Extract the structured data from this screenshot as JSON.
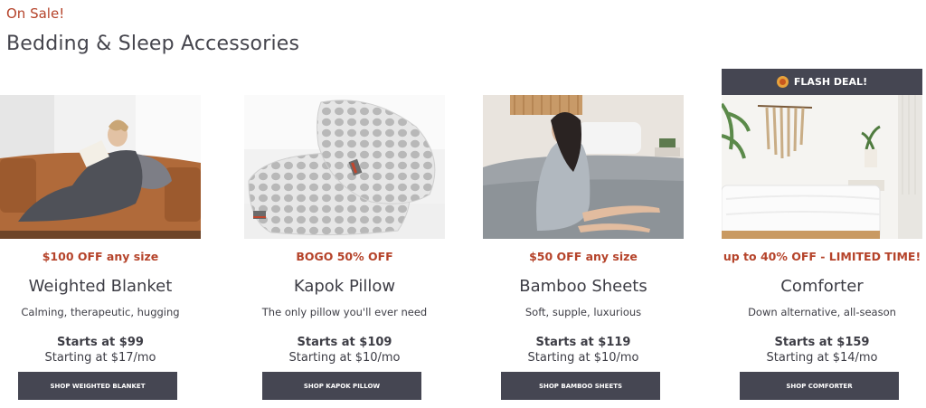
{
  "header": {
    "eyebrow": "On Sale!",
    "title": "Bedding & Sleep Accessories"
  },
  "products": [
    {
      "promo": "BOGO 50% OFF",
      "name": "Kapok Pillow",
      "tagline": "The only pillow you'll ever need",
      "price": "Starts at $109",
      "monthly": "Starting at $10/mo",
      "button": "SHOP KAPOK PILLOW"
    },
    {
      "promo": "$50 OFF any size",
      "name": "Bamboo Sheets",
      "tagline": "Soft, supple, luxurious",
      "price": "Starts at $119",
      "monthly": "Starting at $10/mo",
      "button": "SHOP BAMBOO SHEETS"
    },
    {
      "badge": "FLASH DEAL!",
      "promo": "up to 40% OFF - LIMITED TIME!",
      "name": "Comforter",
      "tagline": "Down alternative, all-season",
      "price": "Starts at $159",
      "monthly": "Starting at $14/mo",
      "button": "SHOP COMFORTER"
    },
    {
      "promo": "$100 OFF any size",
      "name": "Weighted Blanket",
      "tagline": "Calming, therapeutic, hugging",
      "price": "Starts at $99",
      "monthly": "Starting at $17/mo",
      "button": "SHOP WEIGHTED BLANKET"
    }
  ],
  "colors": {
    "accent": "#b5432a",
    "button_bg": "#454652",
    "text": "#3d3d45"
  }
}
